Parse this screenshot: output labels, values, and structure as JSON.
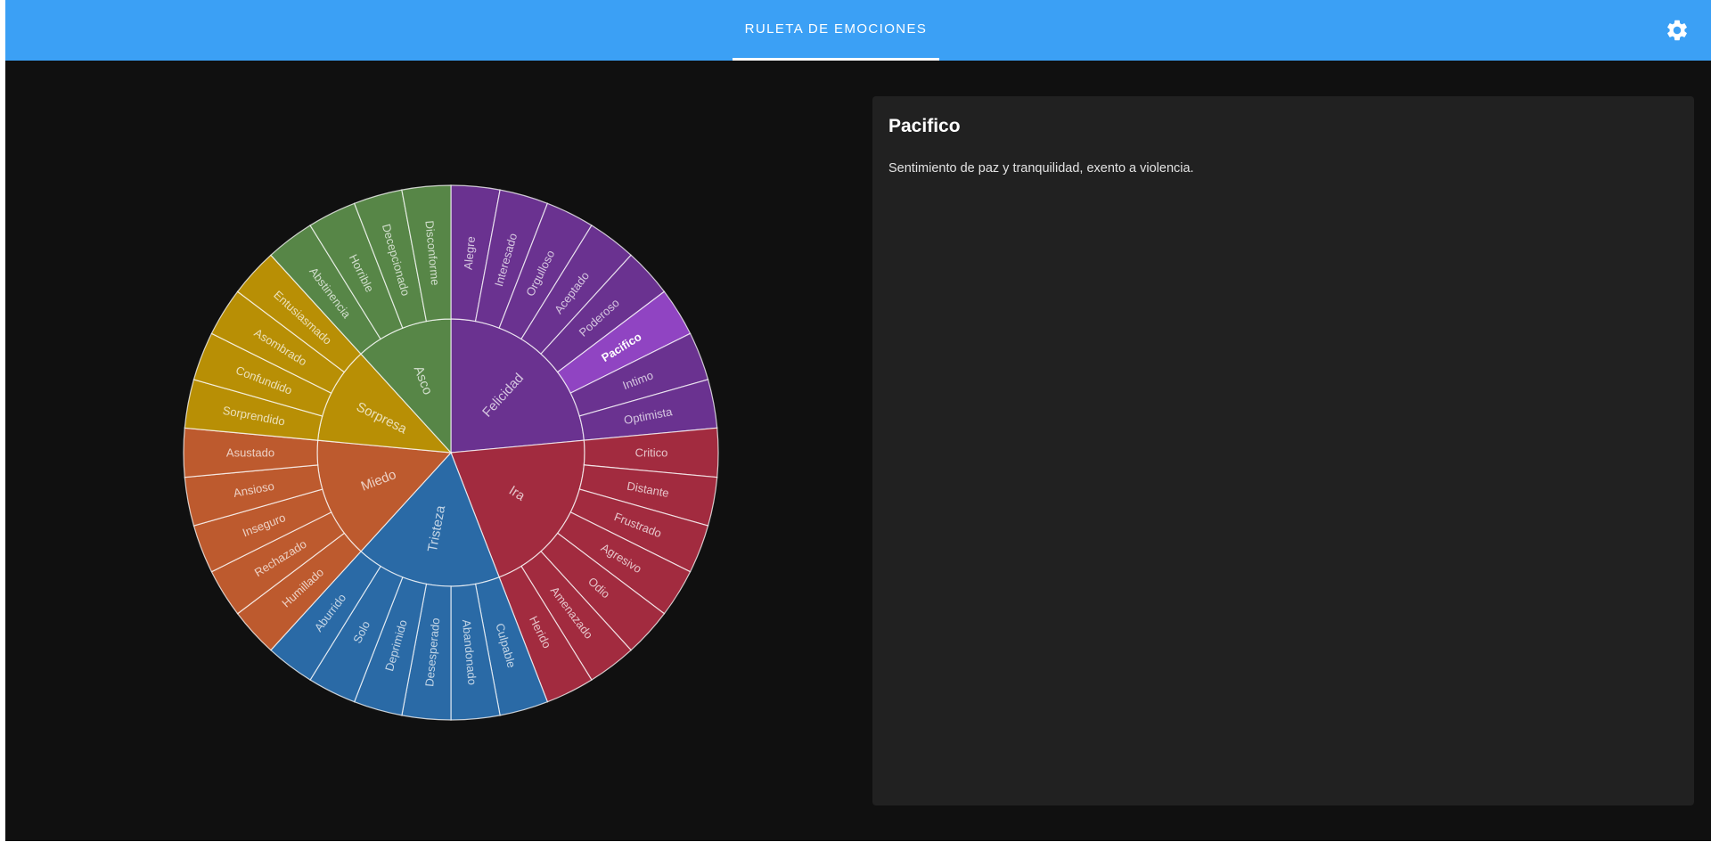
{
  "header": {
    "title": "RULETA DE EMOCIONES",
    "settings_icon": "gear-icon",
    "background": "#3ba0f5"
  },
  "selected": "Pacifico",
  "detail": {
    "title": "Pacifico",
    "description": "Sentimiento de paz y tranquilidad, exento a violencia."
  },
  "wheel": {
    "groups": [
      {
        "name": "Felicidad",
        "color": "#6a3290",
        "highlight": "#9044c2",
        "emotions": [
          "Alegre",
          "Interesado",
          "Orgulloso",
          "Aceptado",
          "Poderoso",
          "Pacifico",
          "Intimo",
          "Optimista"
        ]
      },
      {
        "name": "Ira",
        "color": "#a22b3f",
        "emotions": [
          "Critico",
          "Distante",
          "Frustrado",
          "Agresivo",
          "Odio",
          "Amenazado",
          "Herido"
        ]
      },
      {
        "name": "Tristeza",
        "color": "#2a6aa6",
        "emotions": [
          "Culpable",
          "Abandonado",
          "Desesperado",
          "Deprimido",
          "Solo",
          "Aburrido"
        ]
      },
      {
        "name": "Miedo",
        "color": "#bd5a2e",
        "emotions": [
          "Humillado",
          "Rechazado",
          "Inseguro",
          "Ansioso",
          "Asustado"
        ]
      },
      {
        "name": "Sorpresa",
        "color": "#b88f05",
        "emotions": [
          "Sorprendido",
          "Confundido",
          "Asombrado",
          "Entusiasmado"
        ]
      },
      {
        "name": "Asco",
        "color": "#578647",
        "emotions": [
          "Abstinencia",
          "Horrible",
          "Decepcionado",
          "Disconforme"
        ]
      }
    ]
  }
}
